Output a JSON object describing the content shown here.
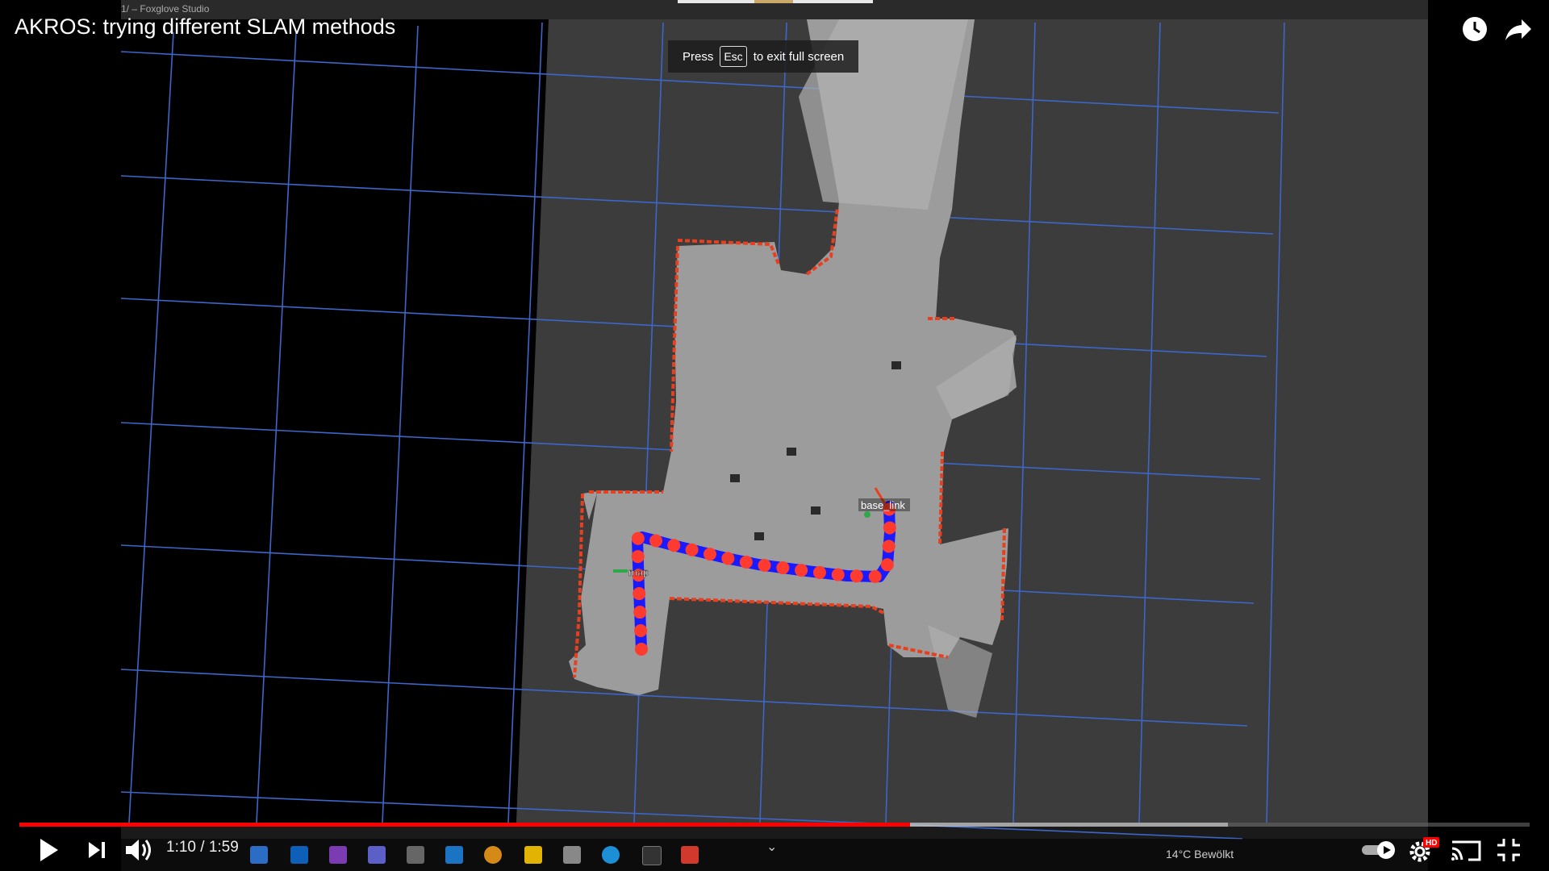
{
  "video": {
    "title": "AKROS: trying different SLAM methods",
    "inner_window_title": "1/ – Foxglove Studio",
    "esc_hint": {
      "press": "Press",
      "key": "Esc",
      "suffix": "to exit full screen"
    },
    "time_current": "1:10",
    "time_separator": "/",
    "time_total": "1:59",
    "progress_played": 0.59,
    "progress_loaded": 0.8
  },
  "scene": {
    "frame_labels": {
      "map": "map",
      "base_link": "base_link"
    },
    "colors": {
      "background": "#000000",
      "ground_plane": "#3c3c3c",
      "map_free": "#9c9c9c",
      "map_obstacle": "#e8401e",
      "grid": "#3c66c8",
      "path_line": "#1a1aff",
      "path_marker": "#ff3b2f"
    }
  },
  "taskbar": {
    "weather": "14°C  Bewölkt",
    "icons": [
      "edge-icon",
      "outlook-icon",
      "onenote-icon",
      "teams-icon",
      "feedback-icon",
      "script-icon",
      "foxglove-icon",
      "notes-icon",
      "store-icon",
      "docker-icon",
      "terminal-icon",
      "recorder-icon"
    ]
  },
  "controls": {
    "icons": [
      "play-icon",
      "next-icon",
      "volume-icon",
      "watch-later-icon",
      "share-icon",
      "autoplay-icon",
      "settings-icon",
      "cast-icon",
      "exit-fullscreen-icon"
    ],
    "hd_badge": "HD"
  }
}
